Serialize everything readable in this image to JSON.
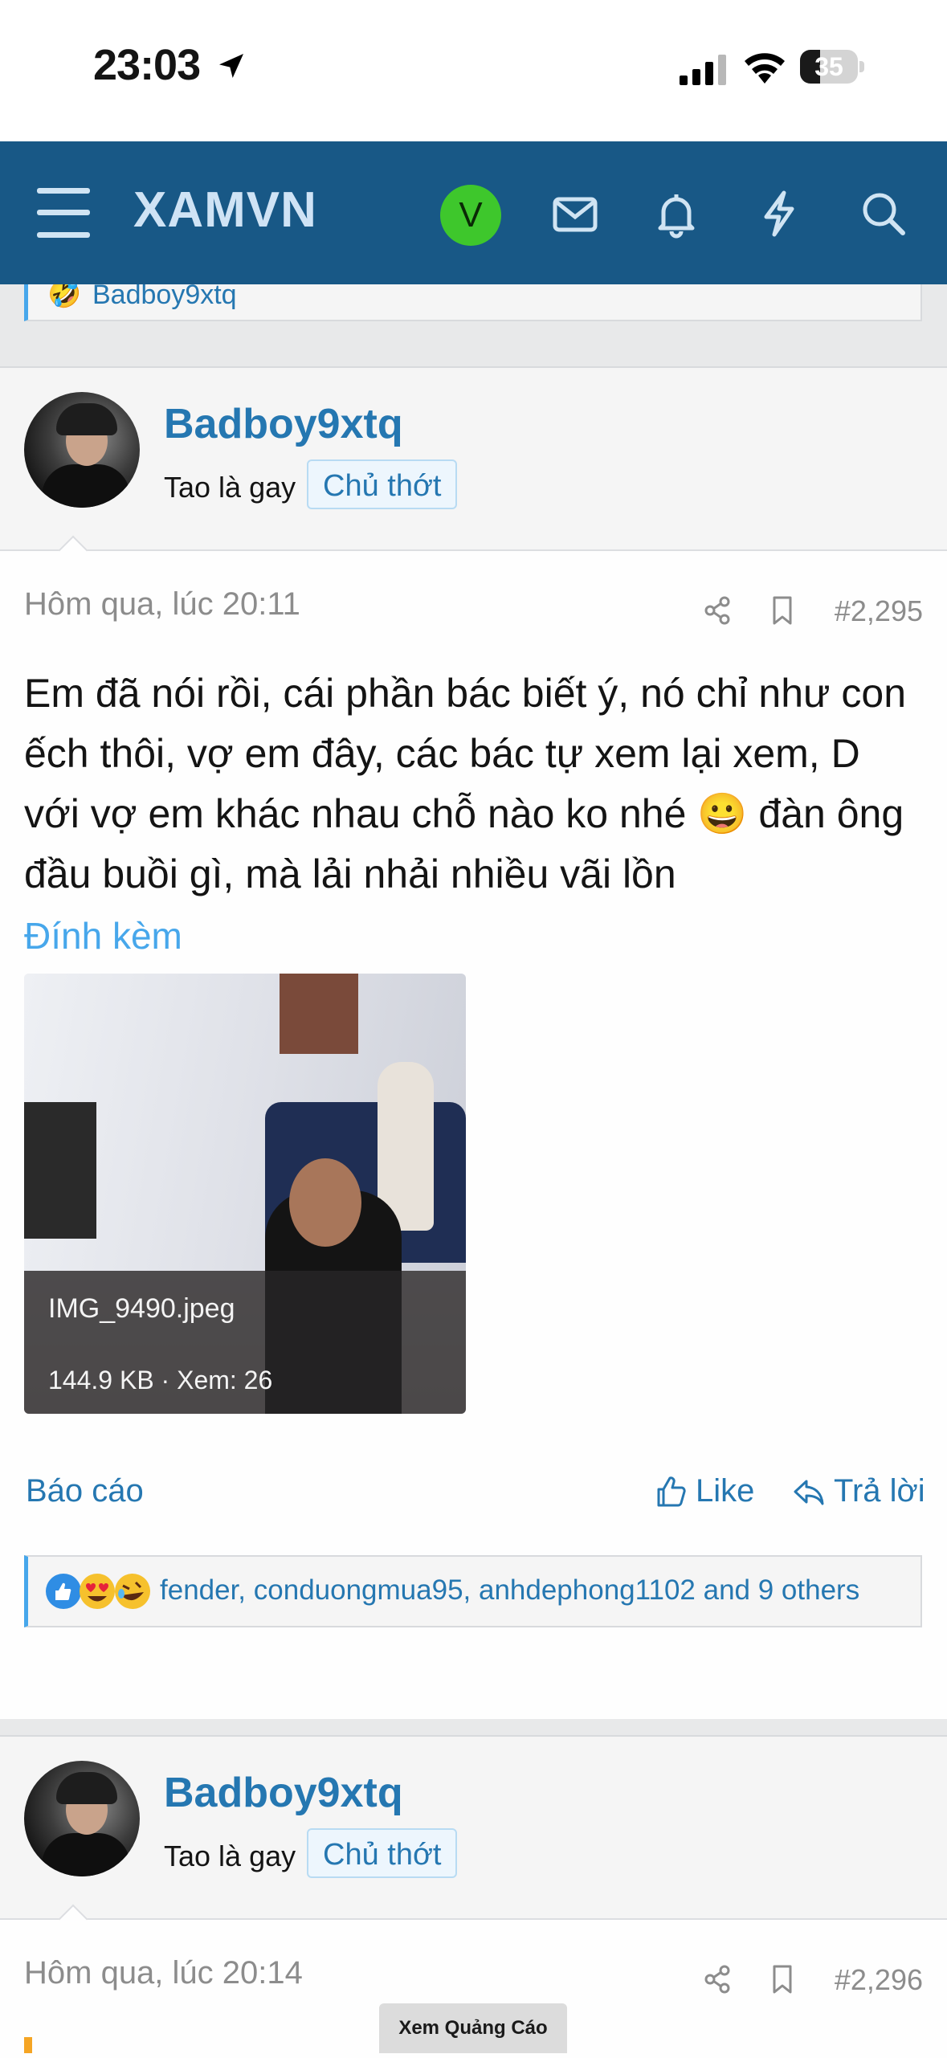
{
  "status_bar": {
    "time": "23:03",
    "battery": "35",
    "battery_level": 0.35
  },
  "nav": {
    "logo": "XAMVN",
    "avatar_letter": "V"
  },
  "prev_reaction": {
    "text": "Badboy9xtq"
  },
  "posts": [
    {
      "username": "Badboy9xtq",
      "user_title": "Tao là gay",
      "badge": "Chủ thớt",
      "date": "Hôm qua, lúc 20:11",
      "number": "#2,295",
      "body": "Em đã nói rồi, cái phần bác biết ý, nó chỉ như con ếch thôi, vợ em đây, các bác tự xem lại xem, D với vợ em khác nhau chỗ nào ko nhé 😀 đàn ông đầu buồi gì, mà lải nhải nhiều vãi lồn",
      "attachments_title": "Đính kèm",
      "attachment": {
        "filename": "IMG_9490.jpeg",
        "meta": "144.9 KB · Xem: 26"
      },
      "actions": {
        "report": "Báo cáo",
        "like": "Like",
        "reply": "Trả lời"
      },
      "reactions": {
        "emojis": [
          "like",
          "heart-eyes",
          "laughing"
        ],
        "text": "fender, conduongmua95, anhdephong1102 and 9 others"
      }
    },
    {
      "username": "Badboy9xtq",
      "user_title": "Tao là gay",
      "badge": "Chủ thớt",
      "date": "Hôm qua, lúc 20:14",
      "number": "#2,296"
    }
  ],
  "ad": {
    "label": "Xem Quảng Cáo"
  },
  "colors": {
    "nav_bg": "#185886",
    "link": "#2577b1",
    "accent": "#47a7eb",
    "avatar_green": "#3ec72c"
  }
}
